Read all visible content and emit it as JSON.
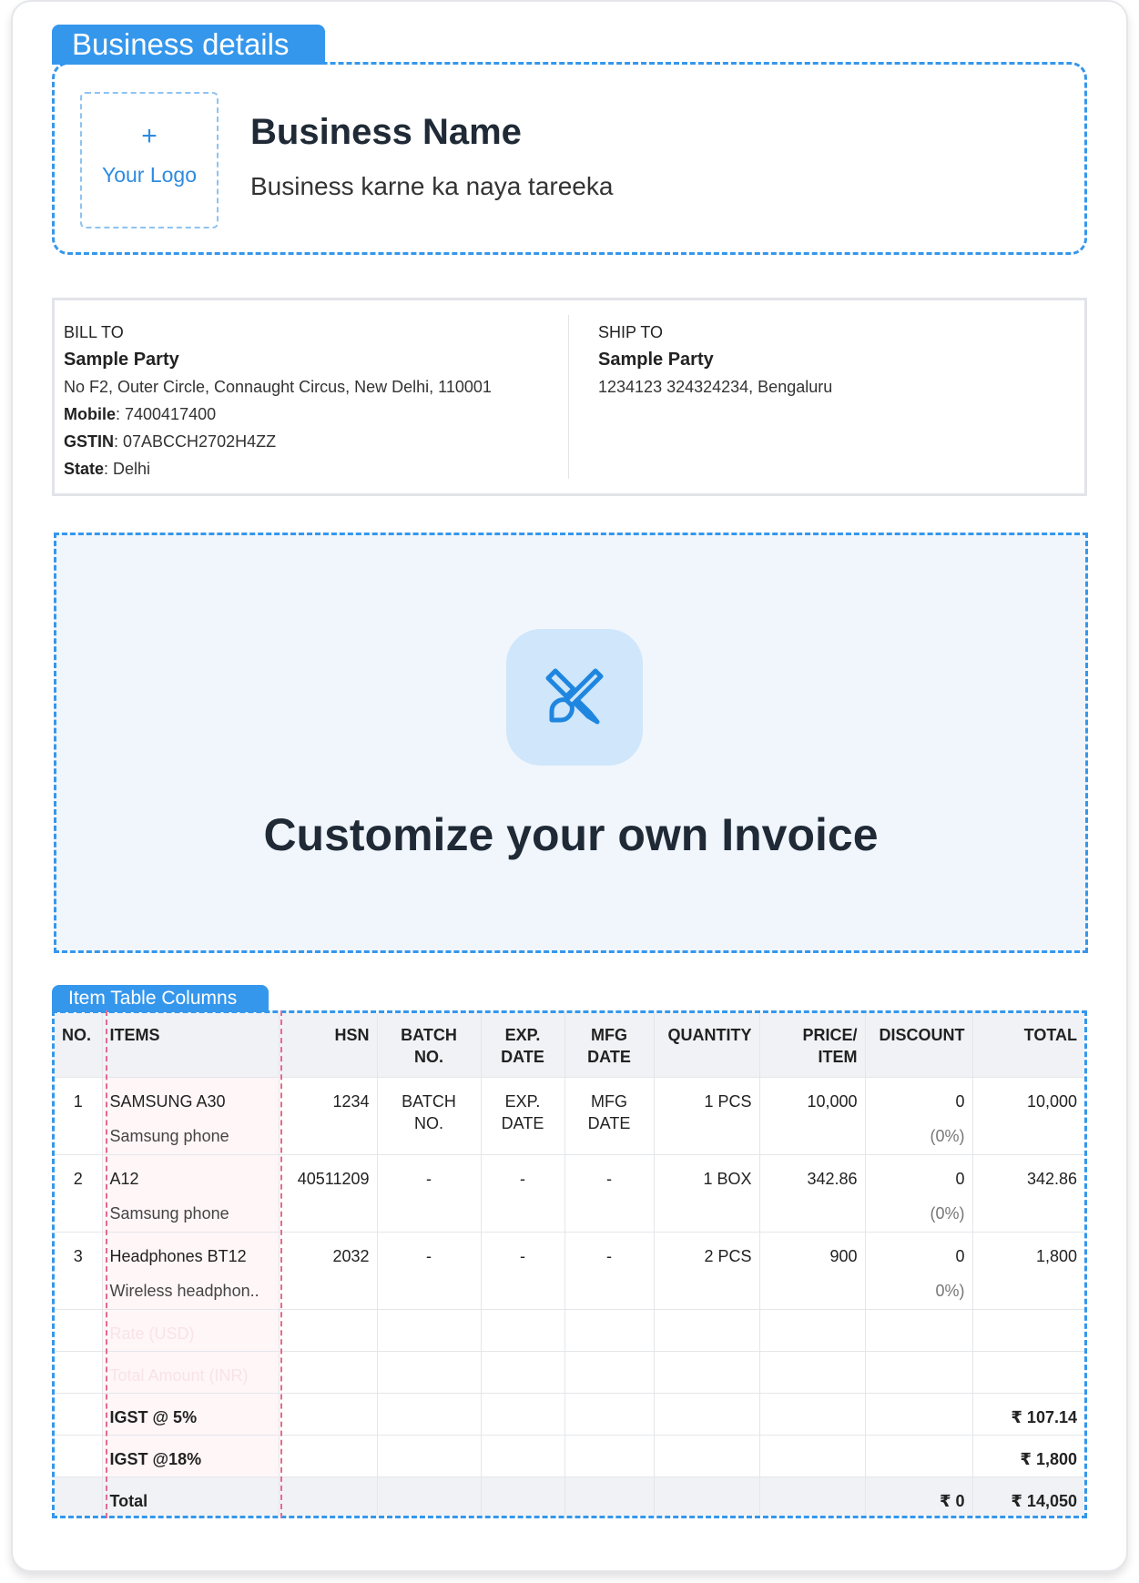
{
  "business_section": {
    "tab_label": "Business details",
    "logo_plus": "+",
    "logo_label": "Your Logo",
    "business_name": "Business Name",
    "tagline": "Business karne ka naya tareeka"
  },
  "bill_to": {
    "heading": "BILL TO",
    "name": "Sample Party",
    "address": "No F2, Outer Circle, Connaught Circus, New Delhi, 110001",
    "mobile_label": "Mobile",
    "mobile": ": 7400417400",
    "gstin_label": "GSTIN",
    "gstin": ": 07ABCCH2702H4ZZ",
    "state_label": "State",
    "state": ": Delhi"
  },
  "ship_to": {
    "heading": "SHIP TO",
    "name": "Sample Party",
    "address": "1234123 324324234, Bengaluru"
  },
  "customize": {
    "title": "Customize your own Invoice",
    "icon": "pencil-brush-icon"
  },
  "item_table": {
    "tab_label": "Item Table Columns",
    "headers": {
      "no": "NO.",
      "items": "ITEMS",
      "hsn": "HSN",
      "batch_1": "BATCH",
      "batch_2": "NO.",
      "exp_1": "EXP.",
      "exp_2": "DATE",
      "mfg_1": "MFG",
      "mfg_2": "DATE",
      "quantity": "QUANTITY",
      "price_1": "PRICE/",
      "price_2": "ITEM",
      "discount": "DISCOUNT",
      "total": "TOTAL"
    },
    "rows": [
      {
        "no": "1",
        "name": "SAMSUNG A30",
        "desc": "Samsung phone",
        "hsn": "1234",
        "batch_1": "BATCH",
        "batch_2": "NO.",
        "exp_1": "EXP.",
        "exp_2": "DATE",
        "mfg_1": "MFG",
        "mfg_2": "DATE",
        "qty": "1 PCS",
        "price": "10,000",
        "discount": "0",
        "discount_pct": "(0%)",
        "total": "10,000"
      },
      {
        "no": "2",
        "name": "A12",
        "desc": "Samsung phone",
        "hsn": "40511209",
        "batch_1": "-",
        "batch_2": "",
        "exp_1": "-",
        "exp_2": "",
        "mfg_1": "-",
        "mfg_2": "",
        "qty": "1 BOX",
        "price": "342.86",
        "discount": "0",
        "discount_pct": "(0%)",
        "total": "342.86"
      },
      {
        "no": "3",
        "name": "Headphones BT12",
        "desc": "Wireless headphon..",
        "hsn": "2032",
        "batch_1": "-",
        "batch_2": "",
        "exp_1": "-",
        "exp_2": "",
        "mfg_1": "-",
        "mfg_2": "",
        "qty": "2 PCS",
        "price": "900",
        "discount": "0",
        "discount_pct": "0%)",
        "total": "1,800"
      }
    ],
    "ghost_1": "Rate (USD)",
    "ghost_2": "Total Amount (INR)",
    "tax_1_label": "IGST @ 5%",
    "tax_1_value": "₹ 107.14",
    "tax_2_label": "IGST @18%",
    "tax_2_value": "₹ 1,800",
    "total_label": "Total",
    "total_discount": "₹ 0",
    "total_value": "₹ 14,050"
  },
  "colors": {
    "accent": "#3597ec",
    "items_highlight": "#e46a8e",
    "icon_bg": "#cfe6fb"
  }
}
